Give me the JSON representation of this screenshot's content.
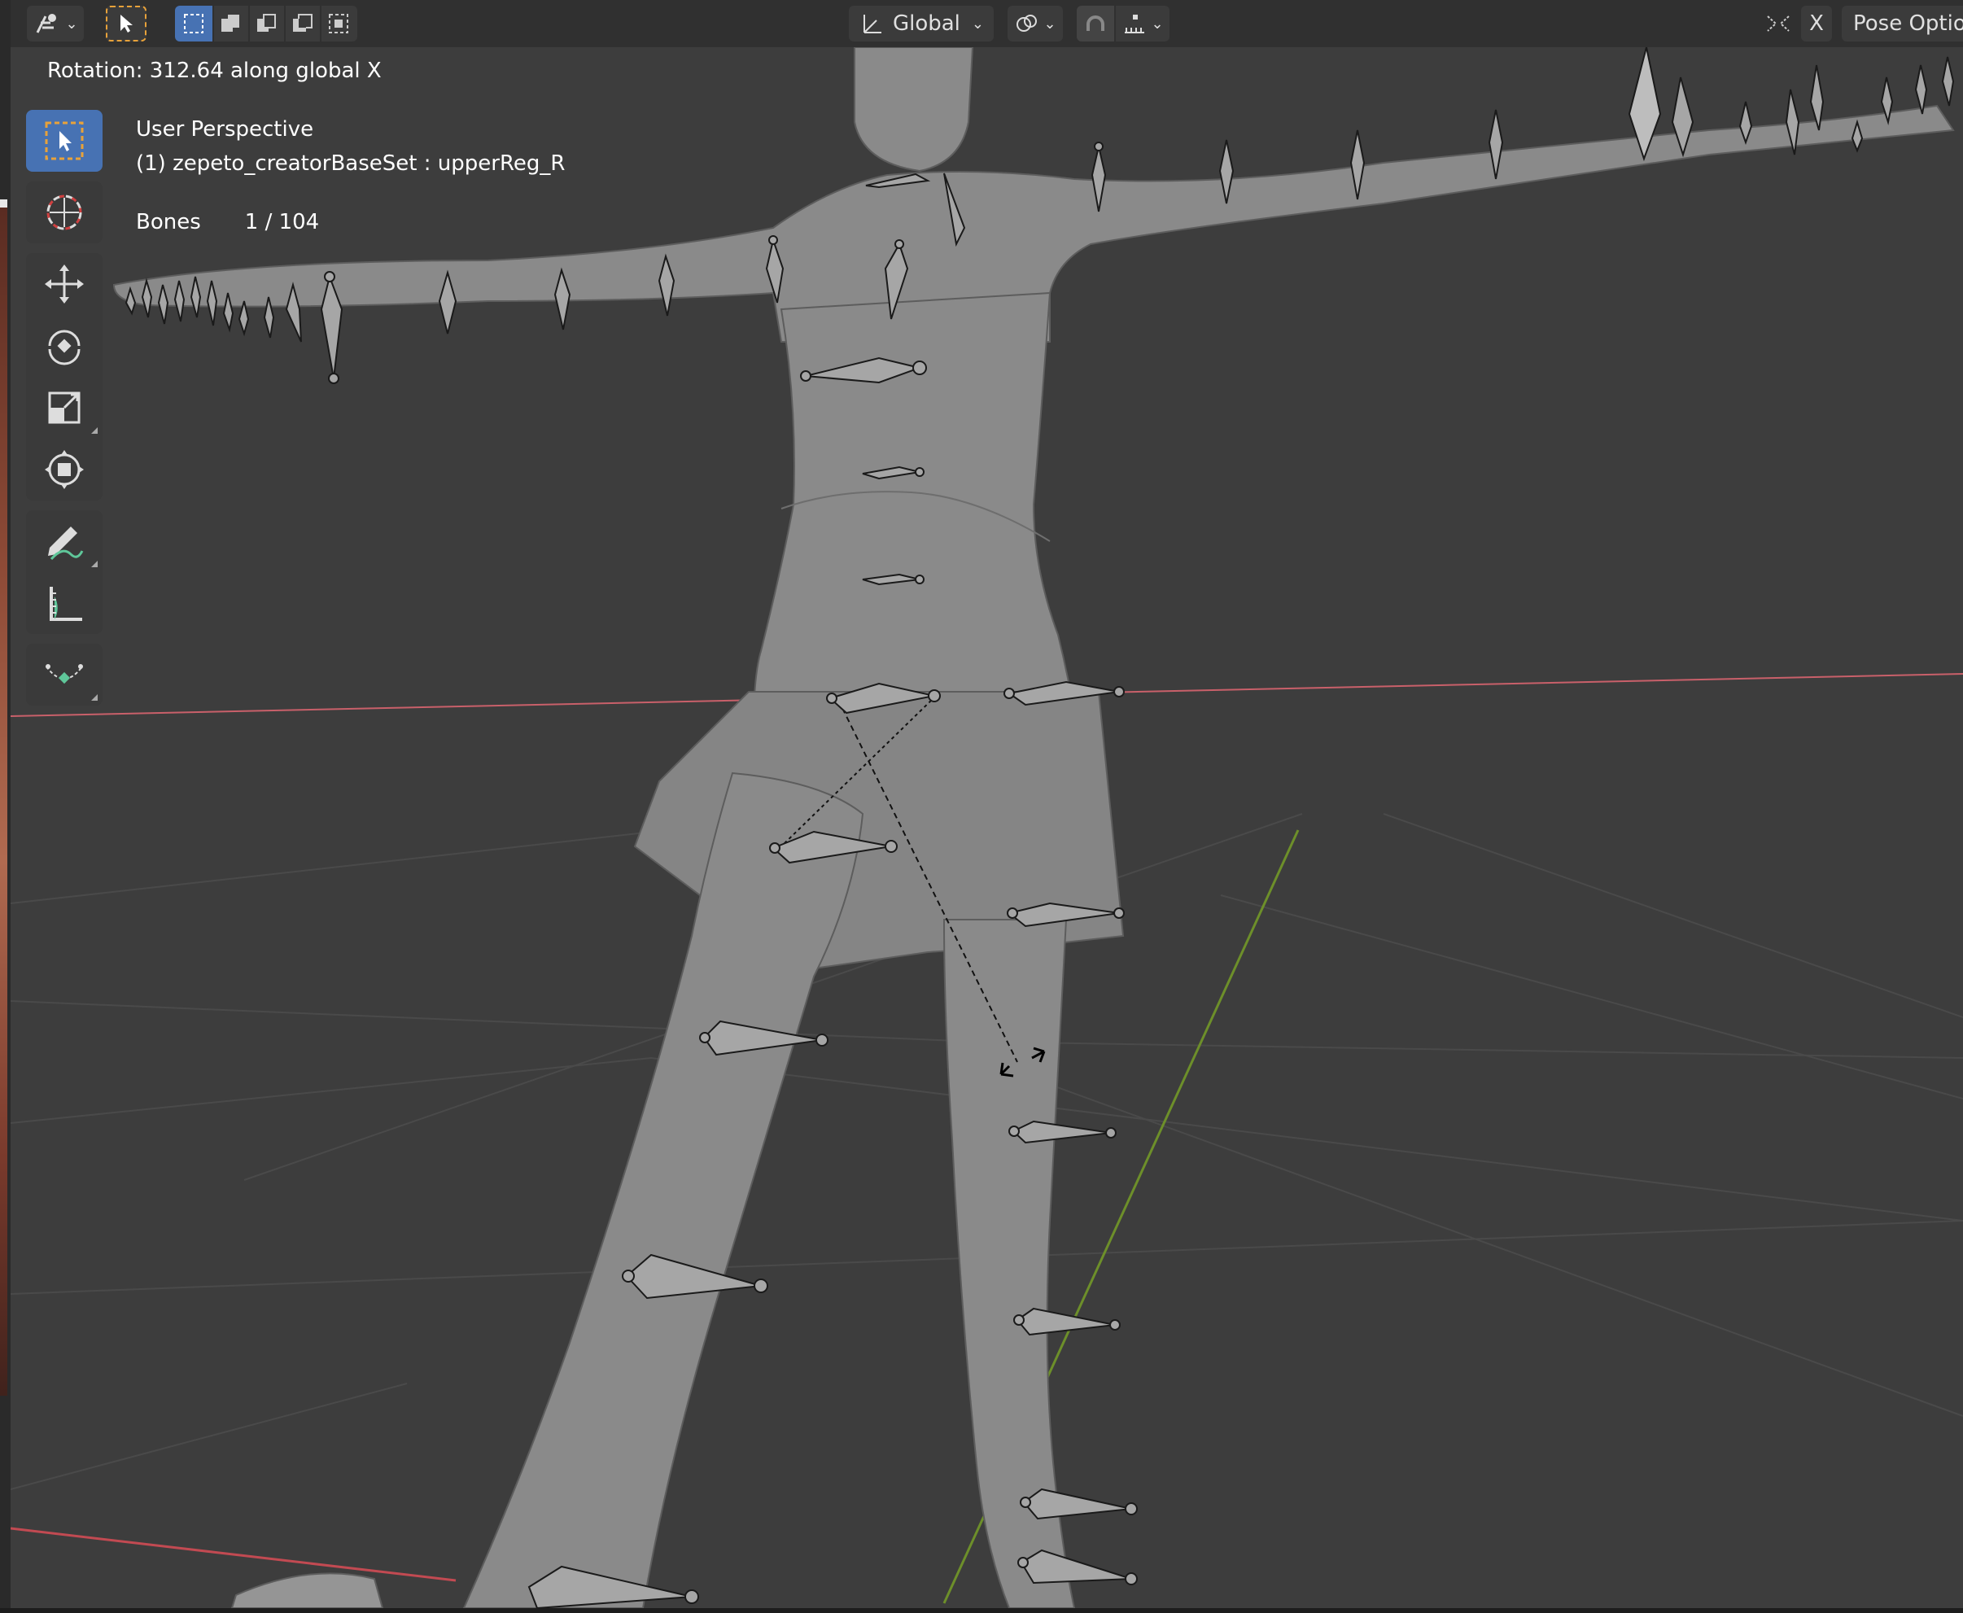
{
  "header": {
    "mode_icon": "pose-mode-icon",
    "select_tool_icon": "select-cursor-icon",
    "selection_modes": [
      "select-new-icon",
      "select-extend-icon",
      "select-subtract-icon",
      "select-difference-icon",
      "select-intersect-icon"
    ],
    "transform_orientation": "Global",
    "pivot_icon": "pivot-point-icon",
    "snap_icon": "snap-magnet-icon",
    "snap_target_icon": "snap-increment-icon",
    "mirror_icon": "x-mirror-icon",
    "mirror_label": "X",
    "pose_options": "Pose Optio"
  },
  "status": {
    "operation": "Rotation: 312.64 along global X"
  },
  "overlay": {
    "view_name": "User Perspective",
    "object_info": "(1) zepeto_creatorBaseSet : upperReg_R",
    "bones_label": "Bones",
    "bones_count": "1 / 104"
  },
  "toolbar": {
    "tools": [
      {
        "name": "select-box-icon"
      },
      {
        "name": "cursor-icon"
      },
      {
        "name": "move-icon"
      },
      {
        "name": "rotate-icon"
      },
      {
        "name": "scale-icon"
      },
      {
        "name": "transform-icon"
      },
      {
        "name": "annotate-icon"
      },
      {
        "name": "measure-icon"
      },
      {
        "name": "relax-pose-icon"
      }
    ]
  },
  "colors": {
    "header_bg": "#303030",
    "viewport_bg": "#3d3d3d",
    "active_blue": "#4772b3",
    "x_axis": "#d96a72",
    "y_axis": "#7ea03a",
    "mesh": "#8c8c8c"
  }
}
